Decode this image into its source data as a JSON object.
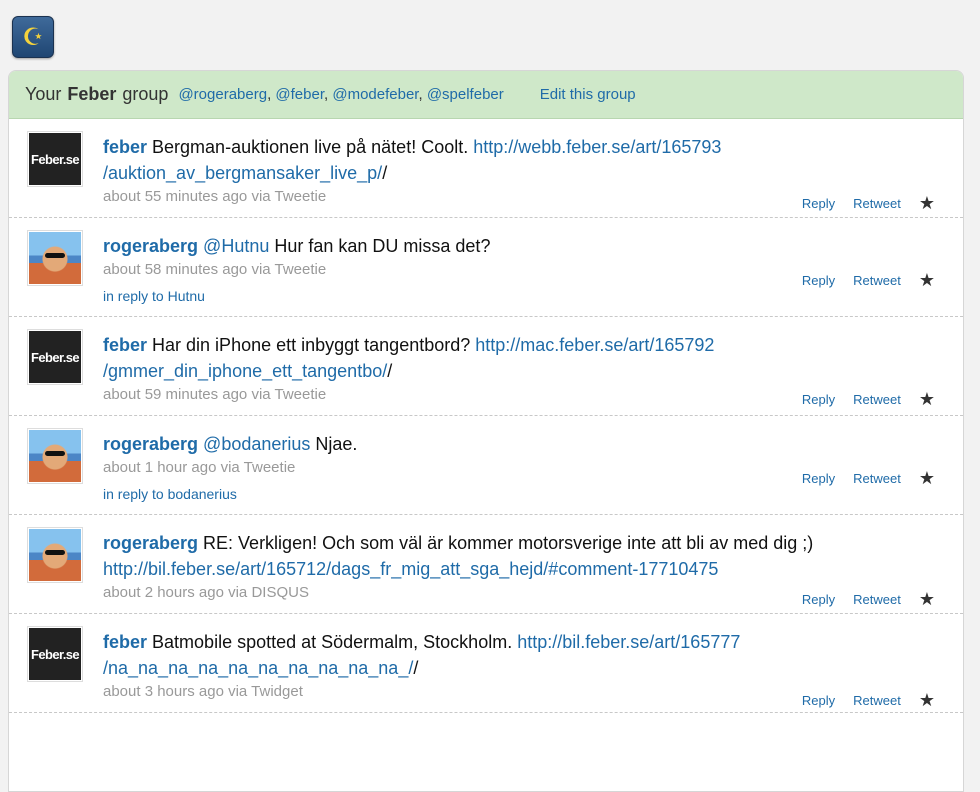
{
  "header": {
    "prefix": "Your",
    "group": "Feber",
    "suffix": "group",
    "members": [
      "@rogeraberg",
      "@feber",
      "@modefeber",
      "@spelfeber"
    ],
    "edit": "Edit this group"
  },
  "actions": {
    "reply": "Reply",
    "retweet": "Retweet",
    "star_icon": "star-icon"
  },
  "tweets": [
    {
      "user": "feber",
      "avatar": "Feber.se",
      "parts": [
        "Bergman-auktionen live på nätet! Coolt. ",
        "http://webb.feber.se/art/165793 /auktion_av_bergmansaker_live_p/",
        "/"
      ],
      "meta": "about 55 minutes ago via Tweetie"
    },
    {
      "user": "rogeraberg",
      "mention": "@Hutnu",
      "text": " Hur fan kan DU missa det?",
      "meta": "about 58 minutes ago via Tweetie",
      "reply_to": "in reply to Hutnu"
    },
    {
      "user": "feber",
      "avatar": "Feber.se",
      "parts": [
        "Har din iPhone ett inbyggt tangentbord? ",
        "http://mac.feber.se/art/165792 /gmmer_din_iphone_ett_tangentbo/",
        "/"
      ],
      "meta": "about 59 minutes ago via Tweetie"
    },
    {
      "user": "rogeraberg",
      "mention": "@bodanerius",
      "text": " Njae.",
      "meta": "about 1 hour ago via Tweetie",
      "reply_to": "in reply to bodanerius"
    },
    {
      "user": "rogeraberg",
      "text": " RE: Verkligen! Och som väl är kommer motorsverige inte att bli av med dig ;)",
      "link": "http://bil.feber.se/art/165712/dags_fr_mig_att_sga_hejd/#comment-17710475",
      "meta": "about 2 hours ago via DISQUS"
    },
    {
      "user": "feber",
      "avatar": "Feber.se",
      "parts": [
        "Batmobile spotted at Södermalm, Stockholm. ",
        "http://bil.feber.se/art/165777 /na_na_na_na_na_na_na_na_na_na_/",
        "/"
      ],
      "meta": "about 3 hours ago via Twidget"
    }
  ],
  "colors": {
    "link": "#1f6ba8",
    "header_bg": "#cfe8c9",
    "meta": "#999999"
  }
}
